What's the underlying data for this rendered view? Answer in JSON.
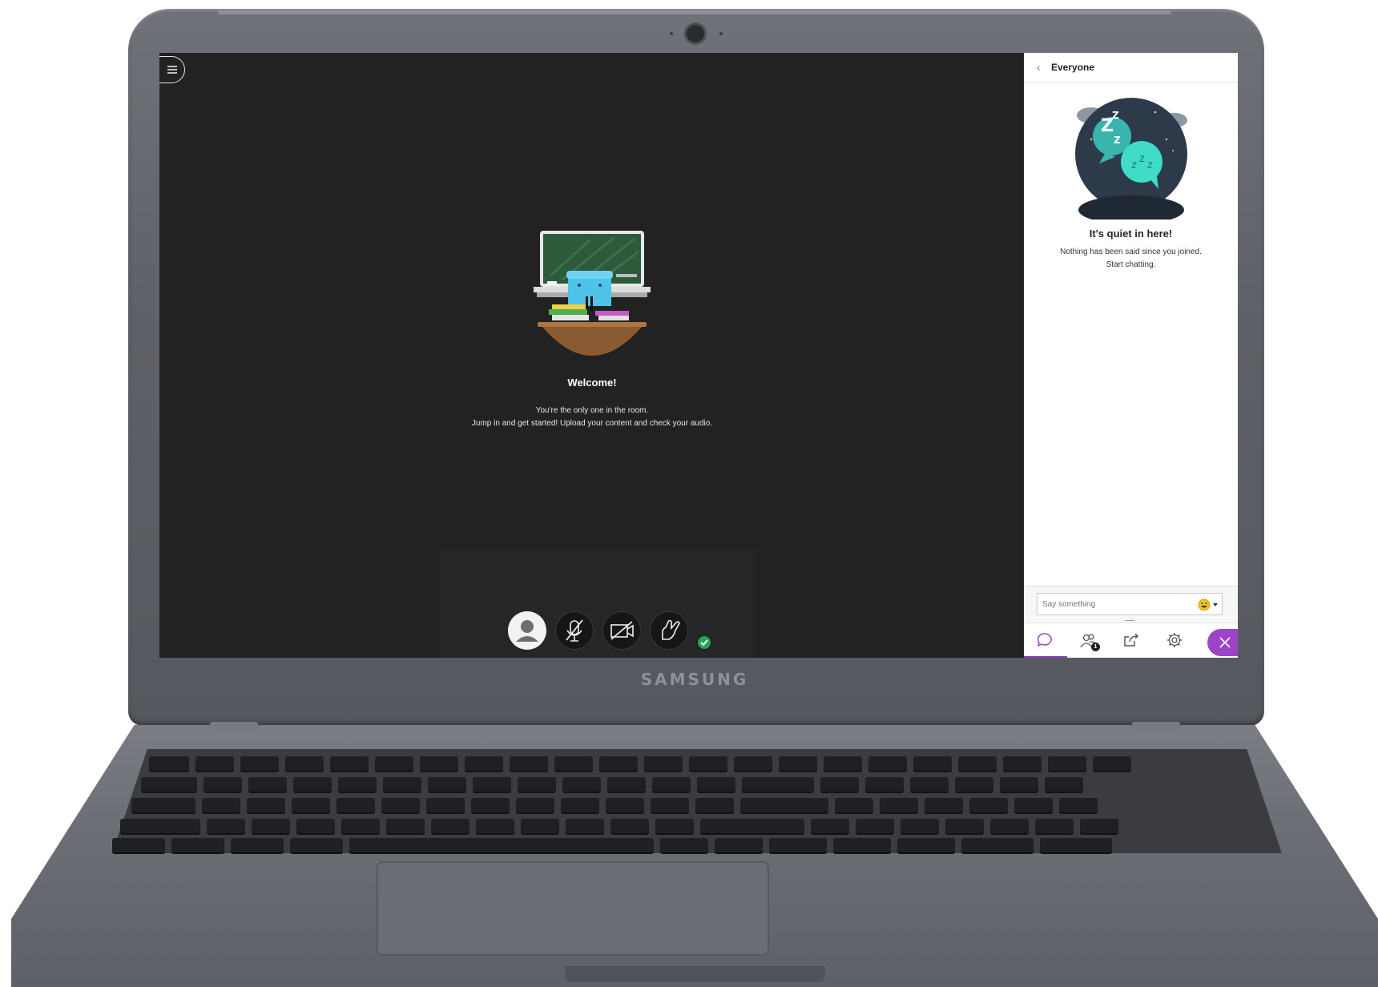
{
  "device": {
    "brand": "SAMSUNG"
  },
  "main": {
    "welcome_title": "Welcome!",
    "welcome_line1": "You're the only one in the room.",
    "welcome_line2": "Jump in and get started! Upload your content and check your audio."
  },
  "panel": {
    "title": "Everyone",
    "empty_title": "It's quiet in here!",
    "empty_line1": "Nothing has been said since you joined.",
    "empty_line2": "Start chatting.",
    "input_placeholder": "Say something",
    "participants_count": "1"
  },
  "colors": {
    "accent": "#9c44c8",
    "status_green": "#27a35c",
    "stage_bg": "#222222"
  },
  "icons": {
    "menu": "hamburger-icon",
    "avatar": "user-avatar-icon",
    "mic": "microphone-muted-icon",
    "camera": "camera-off-icon",
    "hand": "raise-hand-icon",
    "chat": "chat-bubble-icon",
    "attendees": "attendees-icon",
    "share": "share-content-icon",
    "settings": "gear-icon",
    "close": "close-icon",
    "emoji": "emoji-picker-icon"
  }
}
